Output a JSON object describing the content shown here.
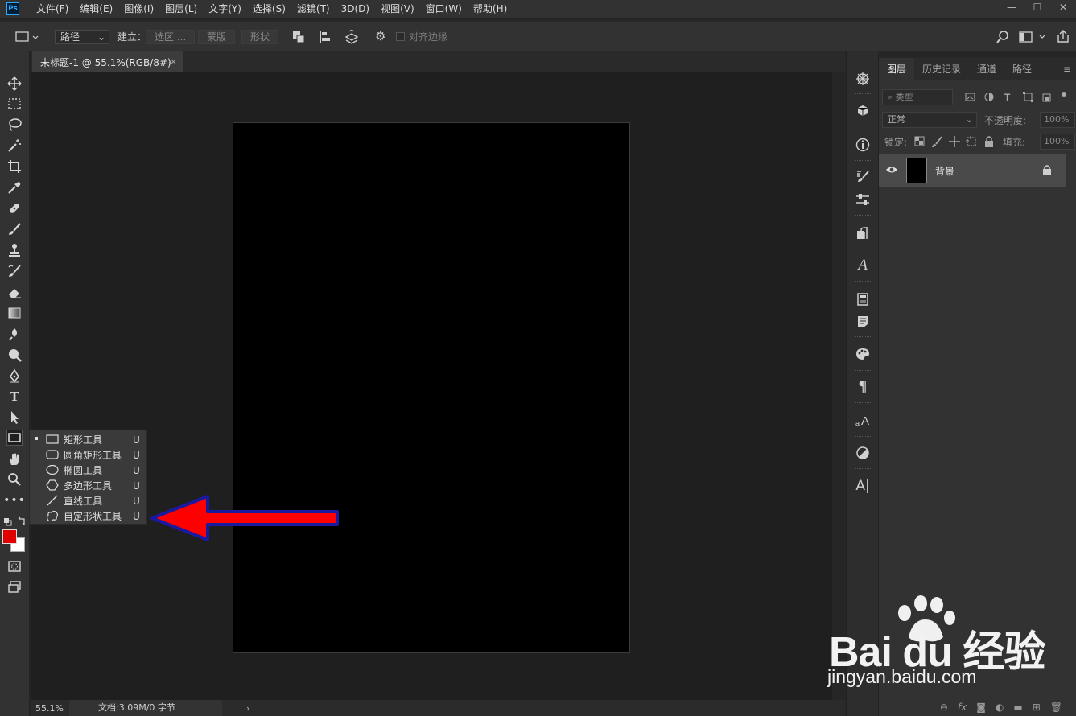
{
  "app": {
    "logo": "Ps"
  },
  "menu": [
    "文件(F)",
    "编辑(E)",
    "图像(I)",
    "图层(L)",
    "文字(Y)",
    "选择(S)",
    "滤镜(T)",
    "3D(D)",
    "视图(V)",
    "窗口(W)",
    "帮助(H)"
  ],
  "window_controls": {
    "minimize": "—",
    "maximize": "☐",
    "close": "✕"
  },
  "options": {
    "mode_select": "路径",
    "build_label": "建立：",
    "selection_button": "选区 ...",
    "mask_button": "蒙版",
    "shape_button": "形状",
    "align_edges_label": "对齐边缘"
  },
  "document_tab": {
    "title": "未标题-1 @ 55.1%(RGB/8#)",
    "close": "×"
  },
  "status": {
    "zoom": "55.1%",
    "doc_info": "文档:3.09M/0 字节",
    "chevron": "›"
  },
  "flyout": {
    "items": [
      {
        "label": "矩形工具",
        "shortcut": "U",
        "icon": "rectangle-icon",
        "selected": true
      },
      {
        "label": "圆角矩形工具",
        "shortcut": "U",
        "icon": "rounded-rectangle-icon",
        "selected": false
      },
      {
        "label": "椭圆工具",
        "shortcut": "U",
        "icon": "ellipse-icon",
        "selected": false
      },
      {
        "label": "多边形工具",
        "shortcut": "U",
        "icon": "polygon-icon",
        "selected": false
      },
      {
        "label": "直线工具",
        "shortcut": "U",
        "icon": "line-icon",
        "selected": false
      },
      {
        "label": "自定形状工具",
        "shortcut": "U",
        "icon": "custom-shape-icon",
        "selected": false
      }
    ]
  },
  "colors": {
    "foreground": "#e00000",
    "background": "#ffffff",
    "arrow_fill": "#ff0000",
    "arrow_outline": "#1a1aa0"
  },
  "layers_panel": {
    "tabs": [
      "图层",
      "历史记录",
      "通道",
      "路径"
    ],
    "filter_placeholder": "类型",
    "blend_mode": "正常",
    "opacity_label": "不透明度:",
    "opacity_value": "100%",
    "lock_label": "锁定:",
    "fill_label": "填充:",
    "fill_value": "100%",
    "layer_name": "背景",
    "footer_icons": [
      "link-icon",
      "fx-icon",
      "mask-icon",
      "adjustment-icon",
      "folder-icon",
      "new-layer-icon",
      "trash-icon"
    ],
    "footer_fx": "fx"
  },
  "watermark": {
    "top": "Bai du 经验",
    "bottom": "jingyan.baidu.com"
  }
}
